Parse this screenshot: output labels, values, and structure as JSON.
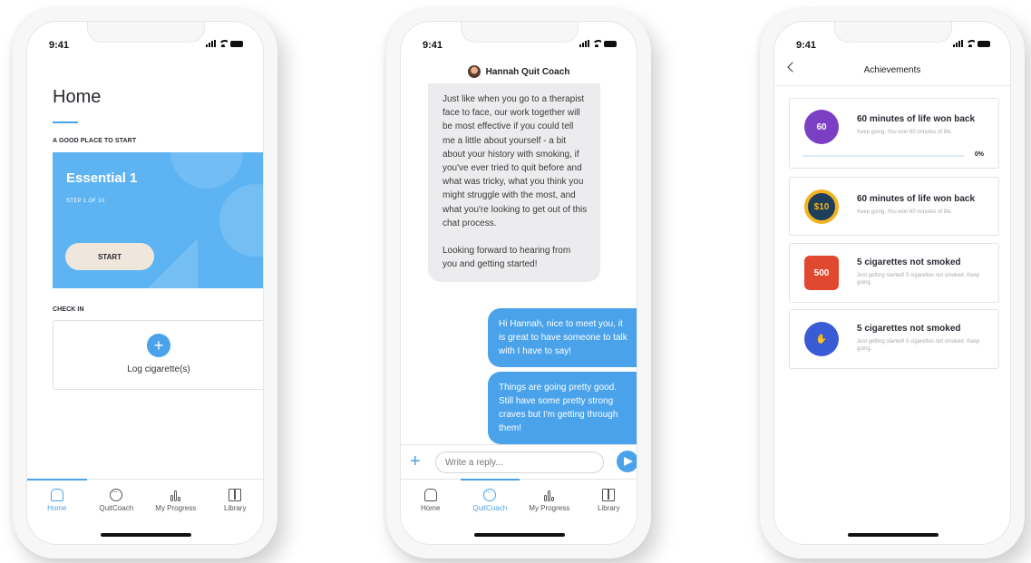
{
  "status": {
    "time": "9:41"
  },
  "screen_home": {
    "title": "Home",
    "good_place_label": "A GOOD PLACE TO START",
    "card": {
      "title": "Essential 1",
      "step": "STEP 1 OF 10",
      "start_label": "START"
    },
    "checkin_label": "CHECK IN",
    "log_label": "Log cigarette(s)",
    "plus": "+"
  },
  "tabs": [
    "Home",
    "QuitCoach",
    "My Progress",
    "Library"
  ],
  "screen_chat": {
    "coach_name": "Hannah Quit Coach",
    "coach_message_1": "Just like when you go to a therapist face to face, our work together will be most effective if you could tell me a little about yourself - a bit about your history with smoking, if you've ever tried to quit before and what was tricky, what you think you might struggle with the most, and what you're looking to get out of this chat process.",
    "coach_message_2": "Looking forward to hearing from you and getting started!",
    "user_message_1": "Hi Hannah, nice to meet you, it is great to have someone to talk with I have to say!",
    "user_message_2": "Things are going pretty good. Still have some pretty strong craves but I'm getting through them!",
    "reply_placeholder": "Write a reply...",
    "plus": "+"
  },
  "screen_achievements": {
    "title": "Achievements",
    "items": [
      {
        "title": "60 minutes of life won back",
        "desc": "Keep going. You won 60 minutes of life.",
        "badge": "60",
        "progress": "0%",
        "badge_color": "#7b3fc4"
      },
      {
        "title": "60 minutes of life won back",
        "desc": "Keep going. You won 60 minutes of life.",
        "badge": "$10",
        "badge_color": "#f2b320"
      },
      {
        "title": "5 cigarettes not smoked",
        "desc": "Just getting started! 5 cigarettes not smoked. Keep going.",
        "badge": "500",
        "badge_color": "#e0492f"
      },
      {
        "title": "5 cigarettes not smoked",
        "desc": "Just getting started! 5 cigarettes not smoked. Keep going.",
        "badge": "",
        "badge_color": "#3a5bd6"
      }
    ]
  },
  "colors": {
    "accent": "#4aa3ea",
    "card_blue": "#5eb4f3",
    "start_button": "#efe7dc"
  }
}
